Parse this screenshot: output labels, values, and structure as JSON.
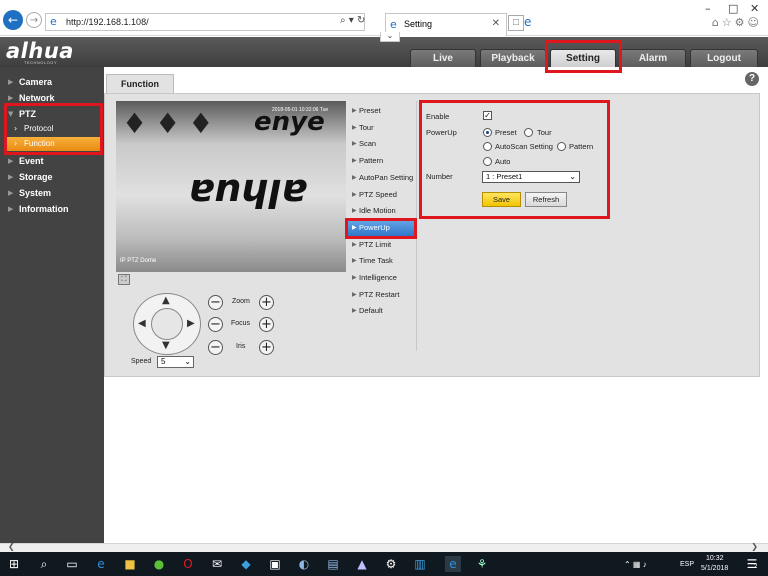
{
  "browser": {
    "url": "http://192.168.1.108/",
    "tab_title": "Setting",
    "addr_tools": "⌕ ▾ ↻"
  },
  "app": {
    "logo": "alhua",
    "logo_sub": "TECHNOLOGY",
    "top_nav": [
      {
        "label": "Live",
        "active": false
      },
      {
        "label": "Playback",
        "active": false
      },
      {
        "label": "Setting",
        "active": true
      },
      {
        "label": "Alarm",
        "active": false
      },
      {
        "label": "Logout",
        "active": false
      }
    ]
  },
  "sidebar": {
    "items": [
      {
        "label": "Camera"
      },
      {
        "label": "Network"
      },
      {
        "label": "PTZ"
      },
      {
        "label": "Event"
      },
      {
        "label": "Storage"
      },
      {
        "label": "System"
      },
      {
        "label": "Information"
      }
    ],
    "ptz_sub": [
      {
        "label": "Protocol",
        "active": false
      },
      {
        "label": "Function",
        "active": true
      }
    ]
  },
  "page": {
    "tab": "Function",
    "help": "?"
  },
  "video": {
    "overlay_label": "IP PTZ Dome",
    "date_overlay": "2018-05-01 10:32:06 Tue"
  },
  "ptz": {
    "zoom": "Zoom",
    "focus": "Focus",
    "iris": "Iris",
    "speed_label": "Speed",
    "speed_value": "5"
  },
  "function_menu": [
    {
      "label": "Preset",
      "active": false
    },
    {
      "label": "Tour",
      "active": false
    },
    {
      "label": "Scan",
      "active": false
    },
    {
      "label": "Pattern",
      "active": false
    },
    {
      "label": "AutoPan Setting",
      "active": false
    },
    {
      "label": "PTZ Speed",
      "active": false
    },
    {
      "label": "Idle Motion",
      "active": false
    },
    {
      "label": "PowerUp",
      "active": true
    },
    {
      "label": "PTZ Limit",
      "active": false
    },
    {
      "label": "Time Task",
      "active": false
    },
    {
      "label": "Intelligence",
      "active": false
    },
    {
      "label": "PTZ Restart",
      "active": false
    },
    {
      "label": "Default",
      "active": false
    }
  ],
  "form": {
    "enable_label": "Enable",
    "enable_checked": true,
    "powerup_label": "PowerUp",
    "options": [
      "Preset",
      "Tour",
      "AutoScan Setting",
      "Pattern",
      "Auto"
    ],
    "selected_option": "Preset",
    "number_label": "Number",
    "number_value": "1 : Preset1",
    "save": "Save",
    "refresh": "Refresh"
  },
  "taskbar": {
    "time": "10:32",
    "date": "5/1/2018",
    "lang": "ESP",
    "notif_count": "2"
  },
  "colors": {
    "highlight": "#e0161e",
    "active_orange": "#f29a22",
    "active_blue": "#2f76c9",
    "save_yellow": "#f7d21c"
  }
}
